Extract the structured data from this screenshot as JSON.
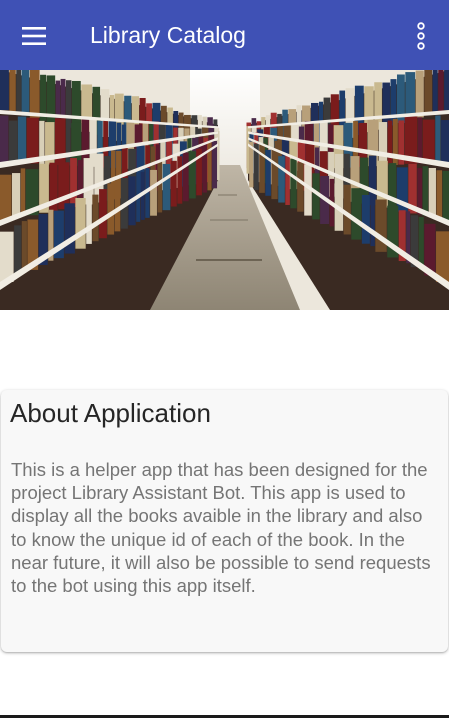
{
  "appbar": {
    "title": "Library Catalog",
    "menu_icon": "hamburger-menu-icon",
    "overflow_icon": "more-vertical-icon",
    "color": "#3f51b5"
  },
  "hero": {
    "subject": "library-bookshelves-aisle-photo"
  },
  "about": {
    "title": "About Application",
    "body": "This is a helper app that has been designed for the project Library Assistant Bot. This app is used to display all the books avaible in the library and also to know the unique id of each of the book. In the near future, it will also be possible to send requests to the bot using this app itself."
  }
}
